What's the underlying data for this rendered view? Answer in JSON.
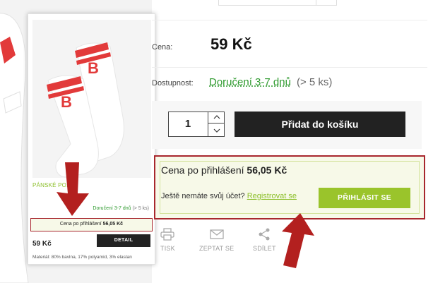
{
  "colors": {
    "accent_green": "#9ac42b",
    "availability_green": "#2e9a2e",
    "highlight_red": "#a8272e",
    "dark_button": "#222222"
  },
  "card": {
    "category": "PÁNSKÉ PO...",
    "delivery": "Doručení 3-7 dnů",
    "delivery_extra": "(> 5 ks)",
    "login_price_label": "Cena po přihlášení",
    "login_price_value": "56,05 Kč",
    "price": "59 Kč",
    "detail_button": "DETAIL",
    "material": "Materiál: 80% bavlna, 17% polyamid, 3% elastan"
  },
  "product": {
    "price_label": "Cena:",
    "price_value": "59 Kč",
    "availability_label": "Dostupnost:",
    "availability_value": "Doručení 3-7 dnů",
    "availability_extra": "(> 5 ks)",
    "quantity": "1",
    "add_to_cart": "Přidat do košíku"
  },
  "login_box": {
    "title_label": "Cena po přihlášení",
    "title_value": "56,05 Kč",
    "question": "Ještě nemáte svůj účet?",
    "register_link": "Registrovat se",
    "login_button": "PŘIHLÁSIT SE"
  },
  "actions": [
    {
      "label": "TISK",
      "icon": "printer-icon"
    },
    {
      "label": "ZEPTAT SE",
      "icon": "envelope-icon"
    },
    {
      "label": "SDÍLET",
      "icon": "share-icon"
    }
  ]
}
